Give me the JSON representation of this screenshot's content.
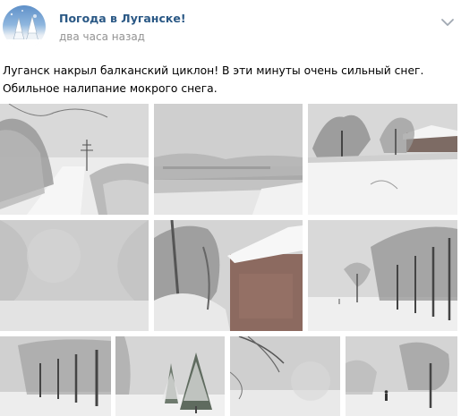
{
  "post": {
    "group_name": "Погода в Луганске!",
    "time": "два часа назад",
    "text": "Луганск накрыл балканский циклон! В эти минуты очень сильный снег. Обильное налипание мокрого снега."
  },
  "icons": {
    "avatar": "snowy-trees-avatar",
    "menu": "chevron-down-icon"
  },
  "colors": {
    "group_name": "#2a5885",
    "time": "#939393",
    "text": "#000000"
  },
  "photos": [
    {
      "subject": "snowy road with trees and power pylon"
    },
    {
      "subject": "foggy snowfall over river and bridge"
    },
    {
      "subject": "snowy yard with tree and house"
    },
    {
      "subject": "heavy snowfall haze"
    },
    {
      "subject": "snow-covered roof of red brick building"
    },
    {
      "subject": "park alley with snowy trees"
    },
    {
      "subject": "row of snowy trees"
    },
    {
      "subject": "snow-covered fir trees"
    },
    {
      "subject": "snowy branches in blizzard"
    },
    {
      "subject": "person walking in snowy park"
    }
  ]
}
